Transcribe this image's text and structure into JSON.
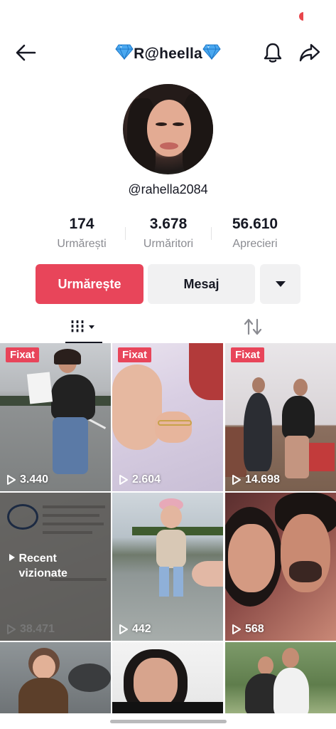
{
  "header": {
    "title": "R@heella",
    "back_icon": "arrow-left-icon",
    "bell_icon": "bell-icon",
    "share_icon": "share-arrow-icon"
  },
  "profile": {
    "username": "@rahella2084"
  },
  "stats": [
    {
      "value": "174",
      "label": "Urmărești"
    },
    {
      "value": "3.678",
      "label": "Urmăritori"
    },
    {
      "value": "56.610",
      "label": "Aprecieri"
    }
  ],
  "actions": {
    "follow_label": "Urmărește",
    "message_label": "Mesaj",
    "more_icon": "caret-down-icon"
  },
  "tabs": {
    "videos_icon": "grid-bars-icon",
    "reposts_icon": "repost-icon"
  },
  "videos": [
    {
      "pinned": "Fixat",
      "views": "3.440"
    },
    {
      "pinned": "Fixat",
      "views": "2.604"
    },
    {
      "pinned": "Fixat",
      "views": "14.698"
    },
    {
      "recent": "Recent vizionate",
      "views": "38.471"
    },
    {
      "views": "442"
    },
    {
      "views": "568"
    }
  ],
  "colors": {
    "accent": "#e8455a",
    "secondary_button": "#f1f1f2",
    "muted_text": "#8a8b91"
  }
}
